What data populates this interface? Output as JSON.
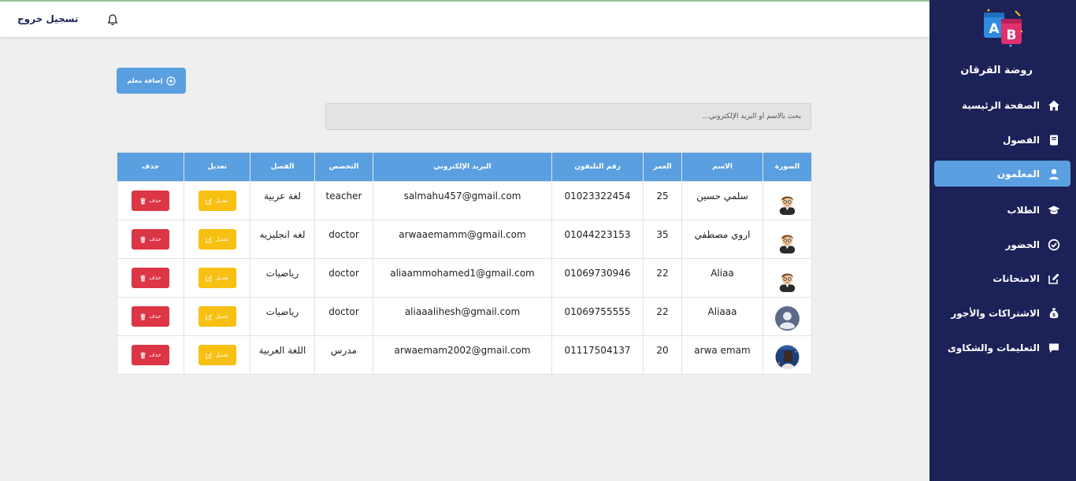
{
  "header": {
    "logout_label": "تسجيل خروج"
  },
  "sidebar": {
    "brand": "روضة القرقان",
    "items": [
      {
        "label": "الصفحة الرئيسية",
        "icon": "home-icon"
      },
      {
        "label": "الفصول",
        "icon": "book-icon"
      },
      {
        "label": "المعلمون",
        "icon": "user-icon",
        "active": true
      },
      {
        "label": "الطلاب",
        "icon": "graduation-cap-icon"
      },
      {
        "label": "الحضور",
        "icon": "check-circle-icon"
      },
      {
        "label": "الامتحانات",
        "icon": "edit-icon"
      },
      {
        "label": "الاشتراكات والأجور",
        "icon": "money-bag-icon"
      },
      {
        "label": "التعليمات والشكاوى",
        "icon": "comment-icon"
      }
    ]
  },
  "toolbar": {
    "add_label": "إضافة معلم"
  },
  "search": {
    "placeholder": "بحث بالاسم أو البريد الإلكتروني..."
  },
  "table": {
    "headers": {
      "photo": "الصورة",
      "name": "الاسم",
      "age": "العمر",
      "phone": "رقم التليفون",
      "email": "البريد الإلكتروني",
      "specialty": "التخصص",
      "class": "الفصل",
      "edit": "تعديل",
      "delete": "حذف"
    },
    "edit_label": "تعديل",
    "delete_label": "حذف",
    "rows": [
      {
        "name": "سلمي حسين",
        "age": "25",
        "phone": "01023322454",
        "email": "salmahu457@gmail.com",
        "specialty": "teacher",
        "class": "لغة عربية",
        "avatar": "cartoon"
      },
      {
        "name": "اروي مصطفي",
        "age": "35",
        "phone": "01044223153",
        "email": "arwaaemamm@gmail.com",
        "specialty": "doctor",
        "class": "لغه انجليزيه",
        "avatar": "cartoon"
      },
      {
        "name": "Aliaa",
        "age": "22",
        "phone": "01069730946",
        "email": "aliaammohamed1@gmail.com",
        "specialty": "doctor",
        "class": "رياضيات",
        "avatar": "cartoon"
      },
      {
        "name": "Aliaaa",
        "age": "22",
        "phone": "01069755555",
        "email": "aliaaalihesh@gmail.com",
        "specialty": "doctor",
        "class": "رياضيات",
        "avatar": "default"
      },
      {
        "name": "arwa emam",
        "age": "20",
        "phone": "01117504137",
        "email": "arwaemam2002@gmail.com",
        "specialty": "مدرس",
        "class": "اللغة العربية",
        "avatar": "photo"
      }
    ]
  },
  "colors": {
    "sidebar_bg": "#1c2157",
    "accent": "#5a9fe0",
    "edit": "#f7c012",
    "delete": "#dc3545"
  }
}
